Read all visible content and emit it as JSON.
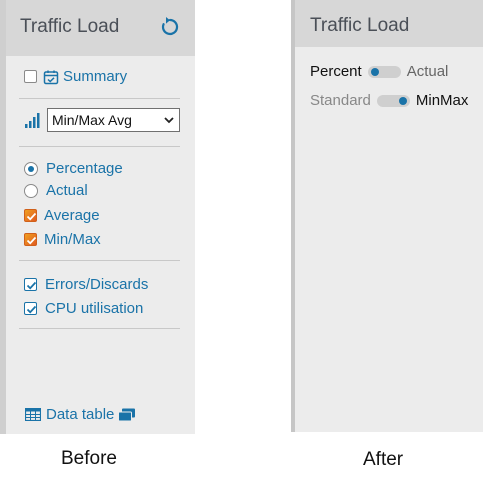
{
  "before": {
    "title": "Traffic Load",
    "summary_label": "Summary",
    "select_value": "Min/Max Avg",
    "options": {
      "percentage": "Percentage",
      "actual": "Actual",
      "average": "Average",
      "minmax": "Min/Max"
    },
    "extras": {
      "errors": "Errors/Discards",
      "cpu": "CPU utilisation"
    },
    "data_table_label": "Data table",
    "caption": "Before"
  },
  "after": {
    "title": "Traffic Load",
    "toggle1": {
      "left": "Percent",
      "right": "Actual",
      "on_side": "left"
    },
    "toggle2": {
      "left": "Standard",
      "right": "MinMax",
      "on_side": "right"
    },
    "caption": "After"
  },
  "colors": {
    "accent": "#1a73a8",
    "panel_bg": "#ececec",
    "header_bg": "#d7d7d7",
    "checkbox_orange": "#e87a20"
  }
}
